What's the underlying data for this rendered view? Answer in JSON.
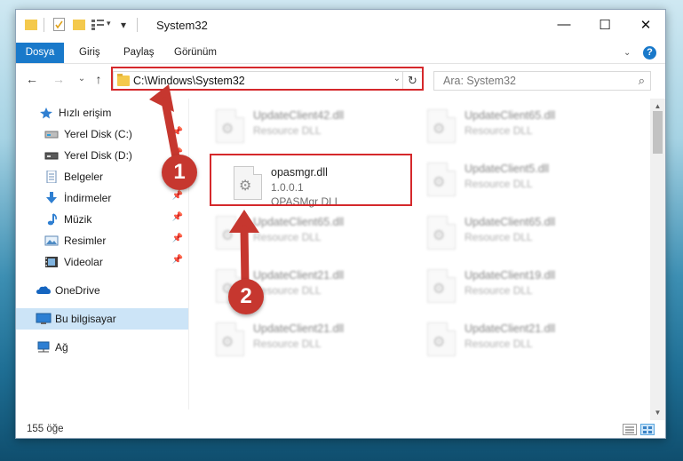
{
  "window": {
    "title": "System32",
    "controls": {
      "minimize": "—",
      "maximize": "☐",
      "close": "✕"
    }
  },
  "ribbon": {
    "tabs": [
      "Dosya",
      "Giriş",
      "Paylaş",
      "Görünüm"
    ],
    "help": "?"
  },
  "navigation": {
    "back": "←",
    "forward": "→",
    "recent": "⌄",
    "up": "↑",
    "address": "C:\\Windows\\System32",
    "search_placeholder": "Ara: System32"
  },
  "sidebar": {
    "quick_access": "Hızlı erişim",
    "items": [
      {
        "label": "Yerel Disk (C:)",
        "icon": "drive-icon",
        "pinned": true
      },
      {
        "label": "Yerel Disk (D:)",
        "icon": "drive-icon",
        "pinned": true
      },
      {
        "label": "Belgeler",
        "icon": "documents-icon",
        "pinned": true
      },
      {
        "label": "İndirmeler",
        "icon": "download-icon",
        "pinned": true
      },
      {
        "label": "Müzik",
        "icon": "music-icon",
        "pinned": true
      },
      {
        "label": "Resimler",
        "icon": "pictures-icon",
        "pinned": true
      },
      {
        "label": "Videolar",
        "icon": "videos-icon",
        "pinned": true
      }
    ],
    "onedrive": "OneDrive",
    "this_pc": "Bu bilgisayar",
    "network": "Ağ"
  },
  "files": [
    {
      "name": "UpdateClient42.dll",
      "line1": "Resource DLL",
      "line2": "",
      "highlighted": false
    },
    {
      "name": "UpdateClient65.dll",
      "line1": "Resource DLL",
      "line2": "",
      "highlighted": false
    },
    {
      "name": "opasmgr.dll",
      "line1": "1.0.0.1",
      "line2": "OPASMgr DLL",
      "highlighted": true
    },
    {
      "name": "UpdateClient5.dll",
      "line1": "Resource DLL",
      "line2": "",
      "highlighted": false
    },
    {
      "name": "UpdateClient65.dll",
      "line1": "Resource DLL",
      "line2": "",
      "highlighted": false
    },
    {
      "name": "UpdateClient65.dll",
      "line1": "Resource DLL",
      "line2": "",
      "highlighted": false
    },
    {
      "name": "UpdateClient21.dll",
      "line1": "Resource DLL",
      "line2": "",
      "highlighted": false
    },
    {
      "name": "UpdateClient19.dll",
      "line1": "Resource DLL",
      "line2": "",
      "highlighted": false
    },
    {
      "name": "UpdateClient21.dll",
      "line1": "Resource DLL",
      "line2": "",
      "highlighted": false
    },
    {
      "name": "UpdateClient21.dll",
      "line1": "Resource DLL",
      "line2": "",
      "highlighted": false
    }
  ],
  "status": {
    "count": "155 öğe"
  },
  "annotations": {
    "step1": "1",
    "step2": "2",
    "color": "#c6372f"
  }
}
